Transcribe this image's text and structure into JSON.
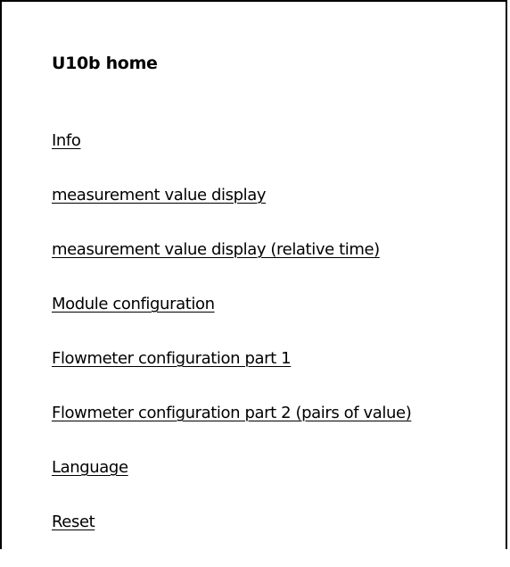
{
  "page": {
    "title": "U10b home"
  },
  "nav": {
    "links": [
      "Info",
      "measurement value display",
      "measurement value display (relative time)",
      "Module configuration",
      "Flowmeter configuration part 1",
      "Flowmeter configuration part 2 (pairs of value)",
      "Language",
      "Reset"
    ]
  },
  "colors": {
    "background": "#ffffff",
    "text": "#000000",
    "border": "#000000"
  }
}
